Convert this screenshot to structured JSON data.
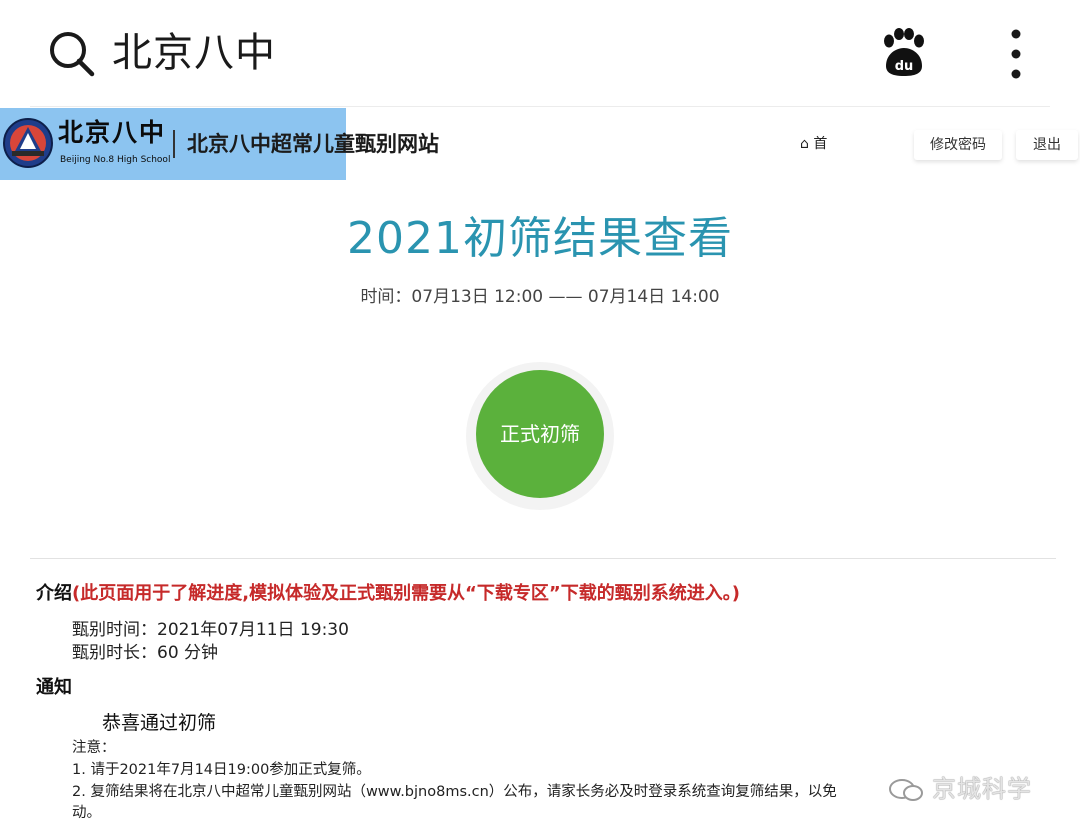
{
  "browser": {
    "search_query": "北京八中",
    "icons": [
      "search-icon",
      "baidu-paw-icon",
      "more-vertical-icon"
    ]
  },
  "site": {
    "logo_cn": "北京八中",
    "logo_en": "Beijing No.8 High School",
    "title": "北京八中超常儿童甄别网站",
    "nav_home": "首",
    "nav_change_password": "修改密码",
    "nav_logout": "退出",
    "logo_bg_color": "#8cc4f0"
  },
  "hero": {
    "title": "2021初筛结果查看",
    "time": "时间：07月13日 12:00 —— 07月14日 14:00",
    "start_button": "正式初筛",
    "title_color": "#2a94b0",
    "button_color": "#5bb13c"
  },
  "intro": {
    "heading": "介绍",
    "note": "(此页面用于了解进度,模拟体验及正式甄别需要从“下载专区”下载的甄别系统进入。)",
    "exam_time": "甄别时间：2021年07月11日 19:30",
    "exam_duration": "甄别时长：60 分钟"
  },
  "notice": {
    "heading": "通知",
    "congrats": "恭喜通过初筛",
    "attention": "注意：",
    "item1": "1. 请于2021年7月14日19:00参加正式复筛。",
    "item2": "2. 复筛结果将在北京八中超常儿童甄别网站（www.bjno8ms.cn）公布，请家长务必及时登录系统查询复筛结果，以免",
    "item3": "动。"
  },
  "watermark": {
    "text": "京城科学"
  }
}
